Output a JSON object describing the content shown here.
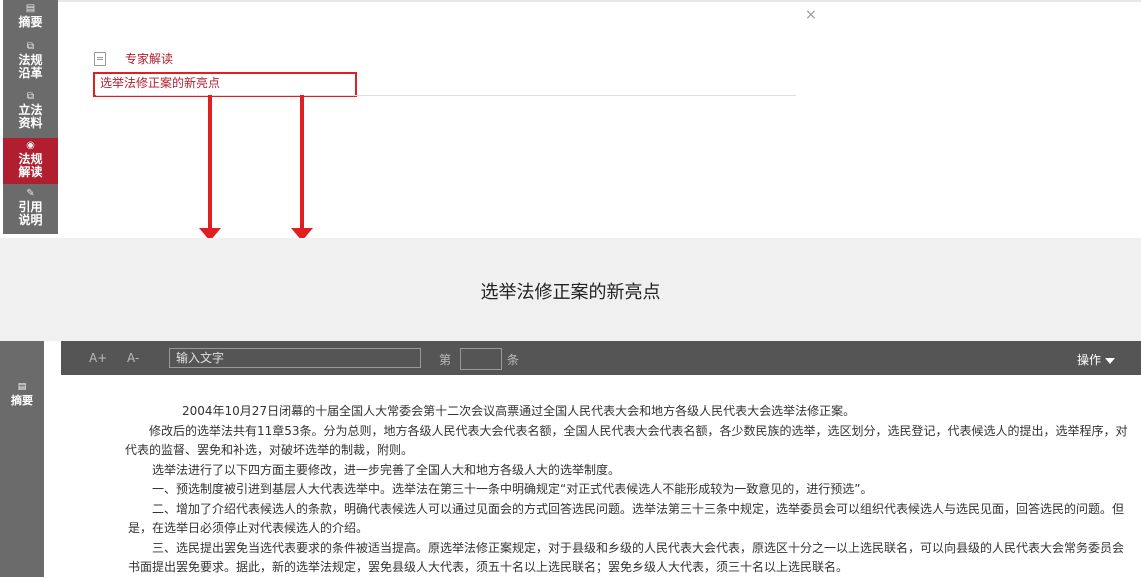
{
  "top_sidebar": {
    "items": [
      {
        "label": "摘要",
        "icon": "list-icon"
      },
      {
        "label": "法规沿革",
        "icon": "copy-icon"
      },
      {
        "label": "立法资料",
        "icon": "copy-icon"
      },
      {
        "label": "法规解读",
        "icon": "eye-icon",
        "active": true
      },
      {
        "label": "引用说明",
        "icon": "edit-icon"
      }
    ]
  },
  "top_panel": {
    "section_label": "专家解读",
    "article_link": "选举法修正案的新亮点",
    "close_glyph": "×"
  },
  "title": "选举法修正案的新亮点",
  "bottom_sidebar": {
    "summary_label": "摘要"
  },
  "toolbar": {
    "font_increase": "A+",
    "font_decrease": "A-",
    "search_placeholder": "输入文字",
    "goto_prefix": "第",
    "goto_suffix": "条",
    "ops_label": "操作"
  },
  "content": {
    "paragraphs": [
      "2004年10月27日闭幕的十届全国人大常委会第十二次会议高票通过全国人民代表大会和地方各级人民代表大会选举法修正案。",
      "修改后的选举法共有11章53条。分为总则，地方各级人民代表大会代表名额，全国人民代表大会代表名额，各少数民族的选举，选区划分，选民登记，代表候选人的提出，选举程序，对代表的监督、罢免和补选，对破坏选举的制裁，附则。",
      "选举法进行了以下四方面主要修改，进一步完善了全国人大和地方各级人大的选举制度。",
      "一、预选制度被引进到基层人大代表选举中。选举法在第三十一条中明确规定“对正式代表候选人不能形成较为一致意见的，进行预选”。",
      "二、增加了介绍代表候选人的条款，明确代表候选人可以通过见面会的方式回答选民问题。选举法第三十三条中规定，选举委员会可以组织代表候选人与选民见面，回答选民的问题。但是，在选举日必须停止对代表候选人的介绍。",
      "三、选民提出罢免当选代表要求的条件被适当提高。原选举法修正案规定，对于县级和乡级的人民代表大会代表，原选区十分之一以上选民联名，可以向县级的人民代表大会常务委员会书面提出罢免要求。据此，新的选举法规定，罢免县级人大代表，须五十名以上选民联名；罢免乡级人大代表，须三十名以上选民联名。"
    ]
  },
  "colors": {
    "sidebar_bg": "#6b6b6b",
    "accent_red": "#b11e2f",
    "annotation_red": "#e02020",
    "toolbar_bg": "#555555",
    "title_band_bg": "#f0f0f0"
  }
}
